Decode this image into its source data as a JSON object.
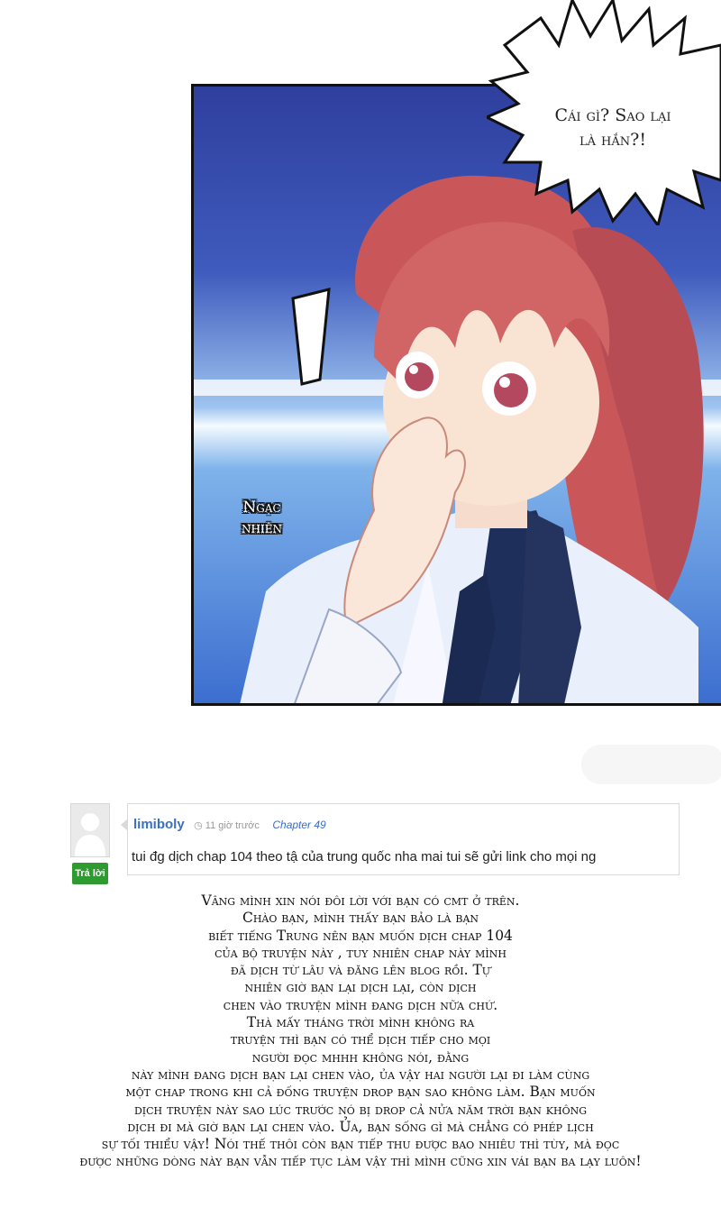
{
  "panel": {
    "speech_lines": [
      "Cái gì? Sao lại",
      "là hắn?!"
    ],
    "sfx_lines": [
      "Ngạc",
      "nhiên"
    ]
  },
  "comment": {
    "username": "limiboly",
    "time": "11 giờ trước",
    "chapter": "Chapter 49",
    "text": "tui đg dịch chap 104 theo tậ của trung quốc nha mai tui sẽ gửi link cho mọi ng",
    "reply_label": "Trả lời"
  },
  "note_lines": [
    "Vâng mình xin nói đôi lời với bạn có cmt ở trên.",
    "Chào bạn, mình thấy bạn bảo là bạn",
    "biết tiếng Trung nên bạn muốn dịch chap 104",
    "của bộ truyện này , tuy nhiên chap này mình",
    "đã dịch từ lâu và đăng lên blog rồi. Tự",
    "nhiên giờ bạn lại dịch lại, còn dịch",
    "chen vào truyện mình đang dịch nữa chứ.",
    "Thà mấy tháng trời mình không ra",
    "truyện thì bạn có thể dịch tiếp cho mọi",
    "người đọc mhhh không nói, đằng",
    "này mình đang dịch bạn lại chen vào, ủa vậy hai người lại đi làm cùng",
    "một chap trong khi cả đống truyện drop bạn sao không làm. Bạn muốn",
    "dịch truyện này sao lúc trước nó bị drop cả nửa năm trời bạn không",
    "dịch đi mà giờ bạn lại chen vào. Ủa, bạn sống gì mà chẳng có phép lịch",
    "sự tối thiểu vậy! Nói thế thôi còn bạn tiếp thu được bao nhiêu thì tùy, mà đọc",
    "được những dòng này bạn vẫn tiếp tục làm vậy thì mình cũng xin vái bạn ba lạy luôn!"
  ]
}
